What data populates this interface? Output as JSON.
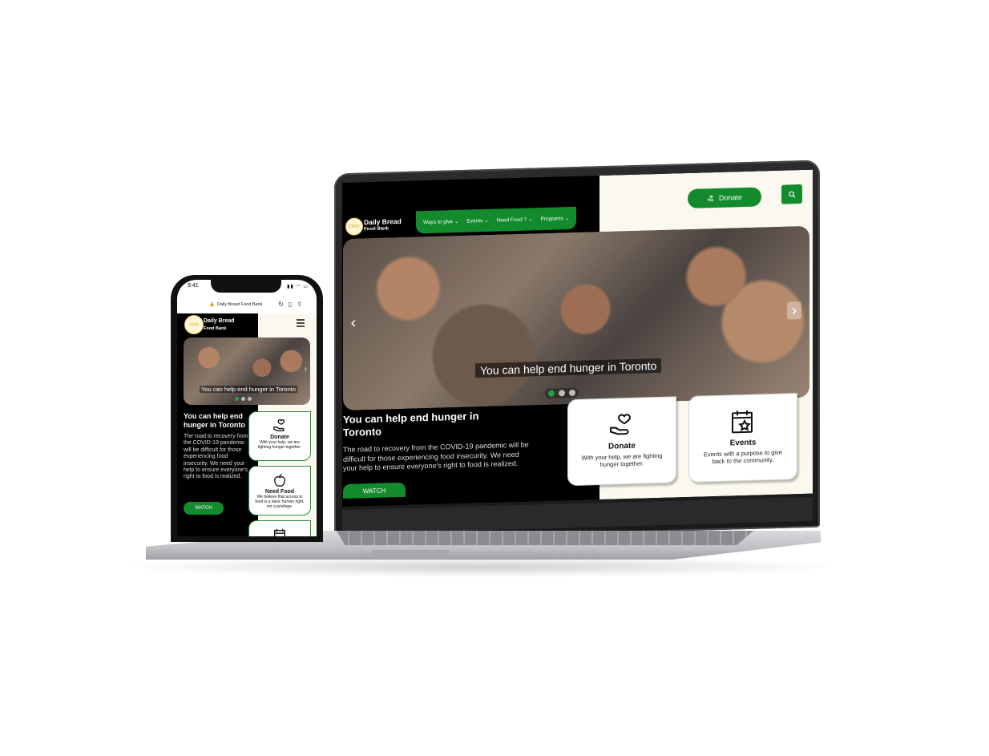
{
  "brand": {
    "name_line1": "Daily Bread",
    "name_line2": "Food Bank",
    "logo_text": "Daily"
  },
  "colors": {
    "accent": "#138a2c",
    "cream": "#fbf9ef",
    "dark": "#000000"
  },
  "laptop": {
    "nav": [
      {
        "label": "Ways to give"
      },
      {
        "label": "Events"
      },
      {
        "label": "Need Food ?"
      },
      {
        "label": "Programs"
      }
    ],
    "donate_label": "Donate",
    "hero_caption": "You can help end hunger in Toronto",
    "heading": "You can help end hunger in Toronto",
    "body": "The road to recovery from the COVID-19 pandemic will be difficult for those experiencing food insecurity.  We need your help to ensure everyone's right to food is realized.",
    "watch_label": "WATCH",
    "cards": [
      {
        "title": "Donate",
        "desc": "With your help, we are fighting hunger together."
      },
      {
        "title": "Events",
        "desc": "Events with a purpose to give back to the community."
      }
    ]
  },
  "phone": {
    "time": "9:41",
    "url": "Daily Bread Food Bank",
    "hero_caption": "You can help end hunger in Toronto",
    "heading": "You can help end hunger in Toronto",
    "body": "The road to recovery from the COVID-19 pandemic will be difficult for those experiencing food insecurity.  We need your help to ensure everyone's right to food is realized.",
    "watch_label": "WATCH",
    "cards": [
      {
        "title": "Donate",
        "desc": "With your help, we are fighting hunger together."
      },
      {
        "title": "Need Food",
        "desc": "We believe that access to food is a basic human right, not a privilege."
      }
    ]
  }
}
